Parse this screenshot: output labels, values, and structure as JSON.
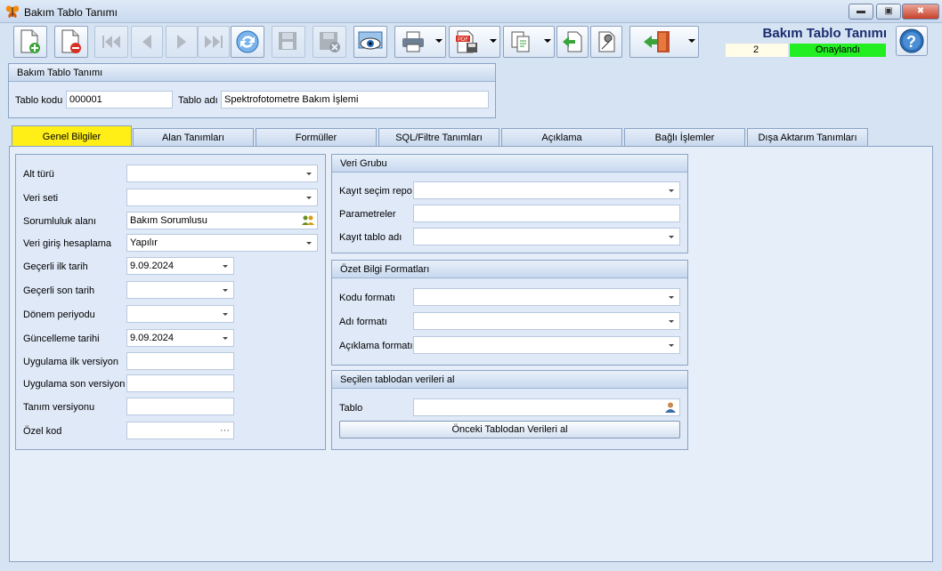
{
  "window": {
    "title": "Bakım Tablo Tanımı",
    "minimize_icon": "minimize-icon",
    "maximize_icon": "maximize-icon",
    "close_icon": "close-icon"
  },
  "toolbar": {
    "buttons": [
      {
        "icon": "new-document-icon"
      },
      {
        "icon": "delete-document-icon"
      },
      {
        "icon": "first-record-icon",
        "disabled": true
      },
      {
        "icon": "previous-record-icon",
        "disabled": true
      },
      {
        "icon": "next-record-icon",
        "disabled": true
      },
      {
        "icon": "last-record-icon",
        "disabled": true
      },
      {
        "icon": "refresh-icon"
      },
      {
        "icon": "save-icon",
        "disabled": true
      },
      {
        "icon": "cancel-save-icon",
        "disabled": true
      },
      {
        "icon": "preview-icon"
      },
      {
        "icon": "print-icon"
      },
      {
        "icon": "export-pdf-icon"
      },
      {
        "icon": "copy-icon"
      },
      {
        "icon": "import-icon"
      },
      {
        "icon": "settings-wrench-icon"
      },
      {
        "icon": "exit-door-icon"
      }
    ]
  },
  "header": {
    "title": "Bakım Tablo Tanımı",
    "record_number": "2",
    "status": "Onaylandı",
    "status_color": "#22ee22",
    "help_icon": "help-icon"
  },
  "definition": {
    "panel_title": "Bakım Tablo Tanımı",
    "code_label": "Tablo kodu",
    "code_value": "000001",
    "name_label": "Tablo adı",
    "name_value": "Spektrofotometre Bakım İşlemi"
  },
  "tabs": [
    {
      "label": "Genel Bilgiler",
      "active": true
    },
    {
      "label": "Alan Tanımları"
    },
    {
      "label": "Formüller"
    },
    {
      "label": "SQL/Filtre Tanımları"
    },
    {
      "label": "Açıklama"
    },
    {
      "label": "Bağlı İşlemler"
    },
    {
      "label": "Dışa Aktarım Tanımları"
    }
  ],
  "general": {
    "fields": [
      {
        "label": "Alt türü",
        "value": ""
      },
      {
        "label": "Veri seti",
        "value": ""
      },
      {
        "label": "Sorumluluk alanı",
        "value": "Bakım Sorumlusu"
      },
      {
        "label": "Veri giriş hesaplama",
        "value": "Yapılır"
      },
      {
        "label": "Geçerli ilk tarih",
        "value": "9.09.2024"
      },
      {
        "label": "Geçerli son tarih",
        "value": ""
      },
      {
        "label": "Dönem periyodu",
        "value": ""
      },
      {
        "label": "Güncelleme tarihi",
        "value": "9.09.2024"
      },
      {
        "label": "Uygulama ilk versiyon",
        "value": ""
      },
      {
        "label": "Uygulama son versiyon",
        "value": ""
      },
      {
        "label": "Tanım versiyonu",
        "value": ""
      },
      {
        "label": "Özel kod",
        "value": "",
        "ellipsis": "···"
      }
    ]
  },
  "data_group": {
    "title": "Veri Grubu",
    "fields": [
      {
        "label": "Kayıt seçim repo",
        "value": ""
      },
      {
        "label": "Parametreler",
        "value": ""
      },
      {
        "label": "Kayıt tablo adı",
        "value": ""
      }
    ]
  },
  "summary_formats": {
    "title": "Özet Bilgi Formatları",
    "fields": [
      {
        "label": "Kodu formatı",
        "value": ""
      },
      {
        "label": "Adı formatı",
        "value": ""
      },
      {
        "label": "Açıklama formatı",
        "value": ""
      }
    ]
  },
  "load_from_table": {
    "title": "Seçilen tablodan verileri al",
    "table_label": "Tablo",
    "table_value": "",
    "button_label": "Önceki Tablodan Verileri al"
  }
}
